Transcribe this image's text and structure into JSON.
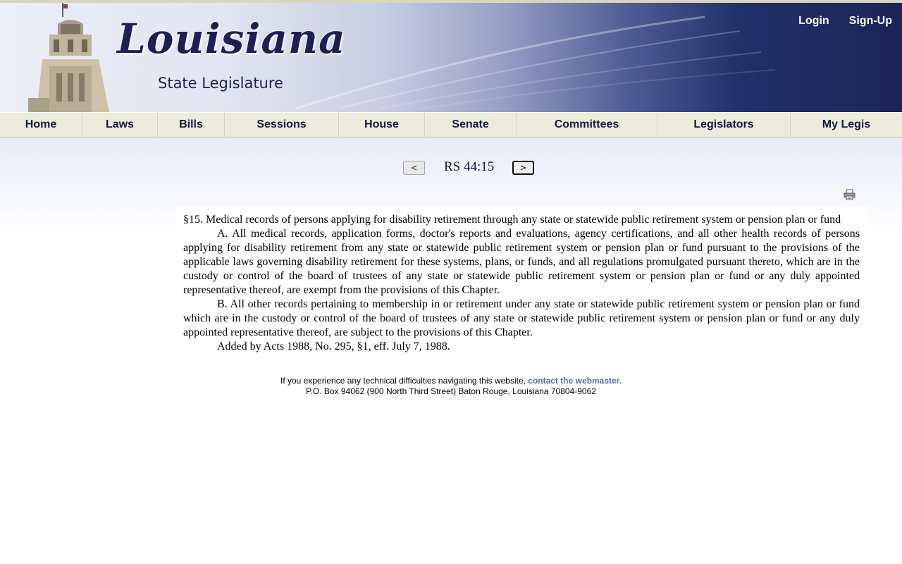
{
  "header": {
    "logo_script": "Louisiana",
    "logo_subtitle": "State Legislature",
    "login": "Login",
    "signup": "Sign-Up"
  },
  "nav": {
    "items": [
      "Home",
      "Laws",
      "Bills",
      "Sessions",
      "House",
      "Senate",
      "Committees",
      "Legislators",
      "My Legis"
    ]
  },
  "pager": {
    "prev": "<",
    "citation": "RS 44:15",
    "next": ">"
  },
  "law": {
    "heading": "§15.  Medical records of persons applying for disability retirement through any state or statewide public retirement system or pension plan or fund",
    "para_a": "A.  All medical records, application forms, doctor's reports and evaluations, agency certifications, and all other health records of persons applying for disability retirement from any state or statewide public retirement system or pension plan or fund pursuant to the provisions of the applicable laws governing disability retirement for these systems, plans, or funds, and all regulations promulgated pursuant thereto, which are in the custody or control of the board of trustees of any state or statewide public retirement system or pension plan or fund or any duly appointed representative thereof, are exempt from the provisions of this Chapter.",
    "para_b": "B.  All other records pertaining to membership in or retirement under any state or statewide public retirement system or pension plan or fund which are in the custody or control of the board of trustees of any state or statewide public retirement system or pension plan or fund or any duly appointed representative thereof, are subject to the provisions of this Chapter.",
    "history": "Added by Acts 1988, No. 295, §1, eff. July 7, 1988."
  },
  "footer": {
    "notice": "If you experience any technical difficulties navigating this website, ",
    "link": "contact the webmaster.",
    "address": "P.O. Box 94062 (900 North Third Street) Baton Rouge, Louisiana 70804-9062"
  },
  "icons": {
    "print": "printer-icon"
  },
  "colors": {
    "brand_navy": "#1d2053",
    "nav_bg": "#edecdc",
    "link": "#5d6a9c"
  }
}
